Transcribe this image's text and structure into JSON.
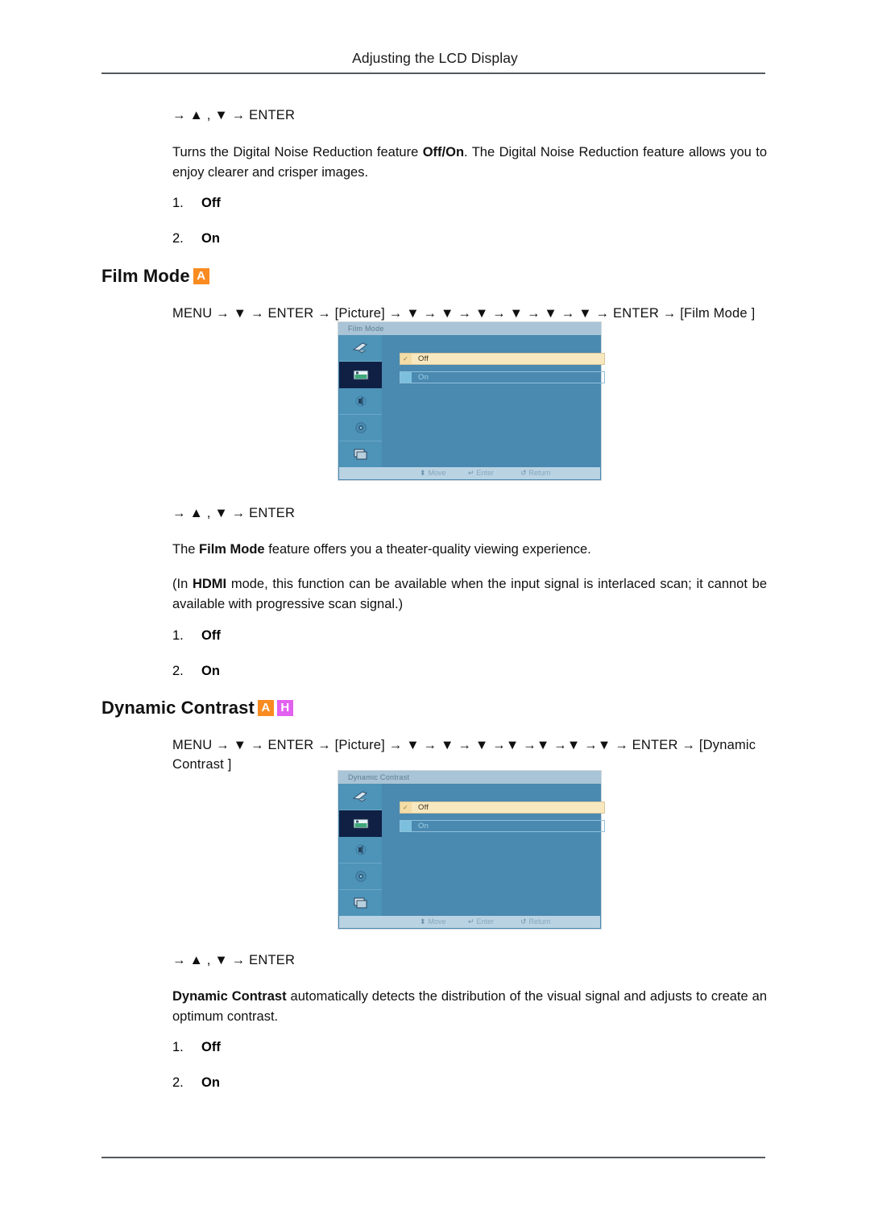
{
  "header": {
    "title": "Adjusting the LCD Display"
  },
  "sections": {
    "dnr": {
      "nav": "→ ▲ , ▼ → ENTER",
      "paragraph_plain": "Turns the Digital Noise Reduction feature Off/On. The Digital Noise Reduction feature allows you to enjoy clearer and crisper images.",
      "paragraph_pre": "Turns the Digital Noise Reduction feature ",
      "paragraph_bold": "Off/On",
      "paragraph_post": ". The Digital Noise Reduction feature allows you to enjoy clearer and crisper images.",
      "options": [
        {
          "num": "1.",
          "label": "Off"
        },
        {
          "num": "2.",
          "label": "On"
        }
      ]
    },
    "film_mode": {
      "heading": "Film Mode",
      "badges": [
        {
          "letter": "A",
          "color": "#f98b20"
        }
      ],
      "menu_path": "MENU → ▼ → ENTER → [Picture] → ▼ → ▼ → ▼ → ▼ → ▼ → ▼ → ENTER → [Film Mode ]",
      "osd": {
        "title": "Film Mode",
        "options": [
          {
            "label": "Off",
            "selected": true
          },
          {
            "label": "On",
            "selected": false
          }
        ],
        "sidebar_icons": [
          "input-source-icon",
          "picture-icon",
          "sound-icon",
          "setup-gear-icon",
          "multi-control-icon"
        ],
        "selected_sidebar_index": 1,
        "footer": [
          {
            "icon": "move-updown-icon",
            "label": "Move"
          },
          {
            "icon": "enter-icon",
            "label": "Enter"
          },
          {
            "icon": "return-icon",
            "label": "Return"
          }
        ]
      },
      "nav": "→ ▲ , ▼ → ENTER",
      "desc_pre": "The ",
      "desc_bold": "Film Mode",
      "desc_post": " feature offers you a theater-quality viewing experience.",
      "note_pre": "(In ",
      "note_bold": "HDMI",
      "note_post": " mode, this function can be available when the input signal is interlaced scan; it cannot be available with progressive scan signal.)",
      "options": [
        {
          "num": "1.",
          "label": "Off"
        },
        {
          "num": "2.",
          "label": "On"
        }
      ]
    },
    "dynamic_contrast": {
      "heading": "Dynamic Contrast",
      "badges": [
        {
          "letter": "A",
          "color": "#f98b20"
        },
        {
          "letter": "H",
          "color": "#e261f0"
        }
      ],
      "menu_path": "MENU → ▼ → ENTER → [Picture] → ▼ → ▼ → ▼ →▼ →▼ →▼ →▼ → ENTER → [Dynamic Contrast ]",
      "osd": {
        "title": "Dynamic Contrast",
        "options": [
          {
            "label": "Off",
            "selected": true
          },
          {
            "label": "On",
            "selected": false
          }
        ],
        "sidebar_icons": [
          "input-source-icon",
          "picture-icon",
          "sound-icon",
          "setup-gear-icon",
          "multi-control-icon"
        ],
        "selected_sidebar_index": 1,
        "footer": [
          {
            "icon": "move-updown-icon",
            "label": "Move"
          },
          {
            "icon": "enter-icon",
            "label": "Enter"
          },
          {
            "icon": "return-icon",
            "label": "Return"
          }
        ]
      },
      "nav": "→ ▲ , ▼ → ENTER",
      "desc_bold": "Dynamic Contrast",
      "desc_post": " automatically detects the distribution of the visual signal and adjusts to create an optimum contrast.",
      "options": [
        {
          "num": "1.",
          "label": "Off"
        },
        {
          "num": "2.",
          "label": "On"
        }
      ]
    }
  }
}
